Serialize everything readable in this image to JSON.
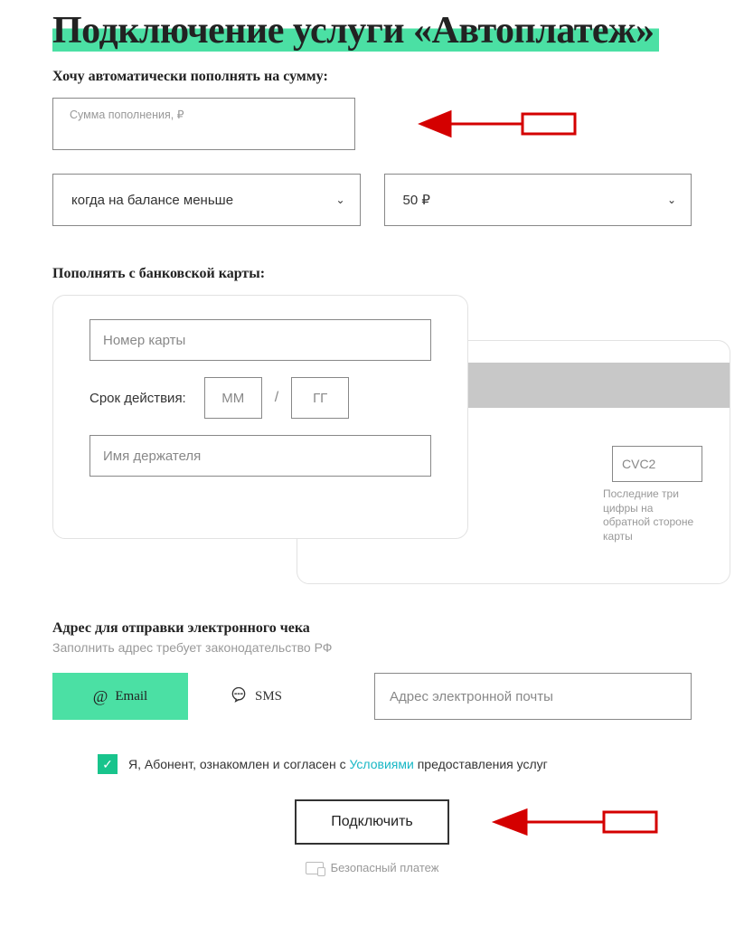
{
  "title": "Подключение услуги «Автоплатеж»",
  "amount": {
    "heading": "Хочу автоматически пополнять на сумму:",
    "placeholder": "Сумма пополнения, ₽"
  },
  "condition": {
    "when_label": "когда на балансе меньше",
    "threshold": "50 ₽"
  },
  "card": {
    "heading": "Пополнять с банковской карты:",
    "number_placeholder": "Номер карты",
    "expiry_label": "Срок действия:",
    "mm": "ММ",
    "yy": "ГГ",
    "slash": "/",
    "holder_placeholder": "Имя держателя",
    "cvc_placeholder": "CVC2",
    "cvc_hint": "Последние три цифры на обратной стороне карты"
  },
  "receipt": {
    "title": "Адрес для отправки электронного чека",
    "subtitle": "Заполнить адрес требует законодательство РФ",
    "tab_email": "Email",
    "tab_sms": "SMS",
    "email_placeholder": "Адрес электронной почты"
  },
  "agreement": {
    "prefix": "Я, Абонент, ознакомлен и согласен с ",
    "link": "Условиями",
    "suffix": " предоставления услуг"
  },
  "submit": "Подключить",
  "secure": "Безопасный платеж"
}
